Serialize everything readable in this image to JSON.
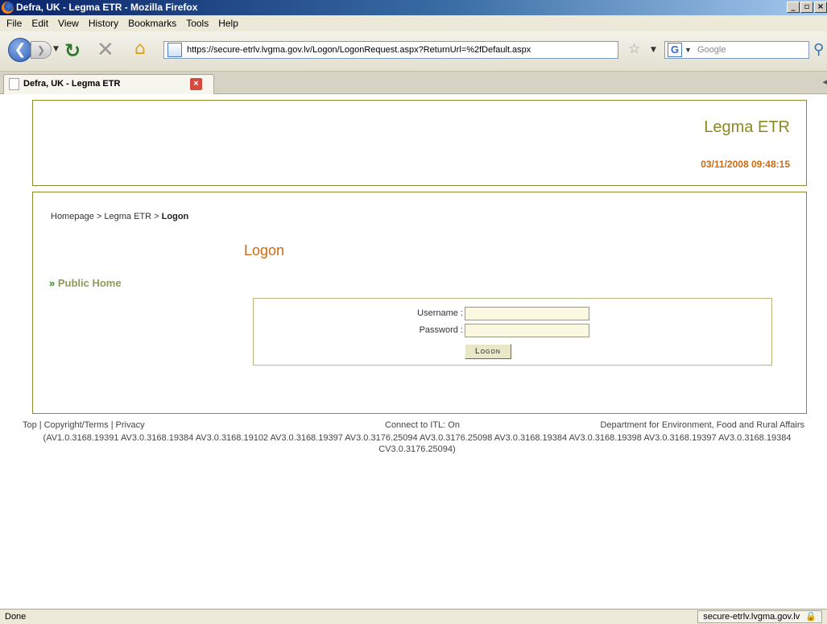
{
  "window": {
    "title": "Defra, UK - Legma ETR - Mozilla Firefox"
  },
  "menu": [
    "File",
    "Edit",
    "View",
    "History",
    "Bookmarks",
    "Tools",
    "Help"
  ],
  "toolbar": {
    "url": "https://secure-etrlv.lvgma.gov.lv/Logon/LogonRequest.aspx?ReturnUrl=%2fDefault.aspx",
    "search_placeholder": "Google"
  },
  "tab": {
    "title": "Defra, UK - Legma ETR"
  },
  "header": {
    "site_title": "Legma ETR",
    "datetime": "03/11/2008 09:48:15"
  },
  "breadcrumb": {
    "home": "Homepage",
    "separator": ">",
    "section": "Legma ETR",
    "current": "Logon"
  },
  "page": {
    "heading": "Logon",
    "side_link": "Public Home"
  },
  "form": {
    "username_label": "Username :",
    "password_label": "Password :",
    "submit_label": "Logon"
  },
  "footer": {
    "links": [
      "Top",
      "Copyright/Terms",
      "Privacy"
    ],
    "itl_status": "Connect to ITL: On",
    "dept": "Department for Environment, Food and Rural Affairs",
    "versions": "(AV1.0.3168.19391 AV3.0.3168.19384 AV3.0.3168.19102 AV3.0.3168.19397 AV3.0.3176.25094 AV3.0.3176.25098 AV3.0.3168.19384 AV3.0.3168.19398 AV3.0.3168.19397 AV3.0.3168.19384 CV3.0.3176.25094)"
  },
  "status": {
    "text": "Done",
    "domain": "secure-etrlv.lvgma.gov.lv"
  }
}
